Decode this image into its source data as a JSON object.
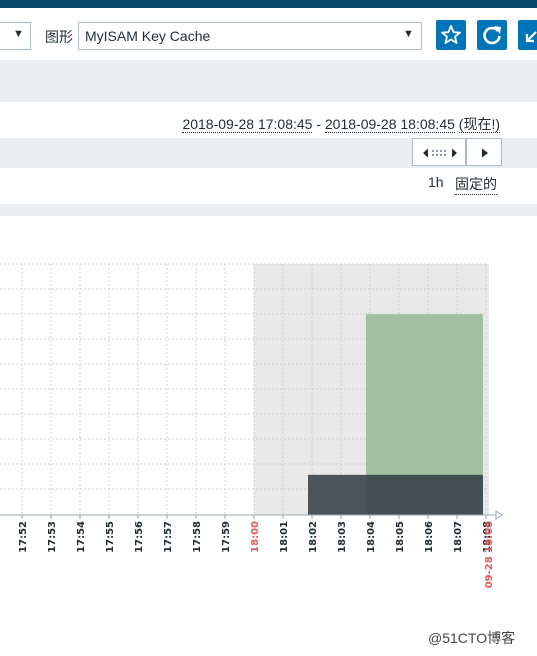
{
  "header": {
    "graph_label": "图形",
    "graph_select_value": "MyISAM Key Cache",
    "buttons": {
      "favorite_icon": "star-icon",
      "refresh_icon": "refresh-icon",
      "kiosk_icon": "arrows-in-icon"
    }
  },
  "timerange": {
    "from": "2018-09-28 17:08:45",
    "separator": "-",
    "to": "2018-09-28 18:08:45",
    "now_label": "(现在!)"
  },
  "timeline": {
    "period": "1h",
    "fixed_label": "固定的"
  },
  "chart_data": {
    "type": "area",
    "x_tick_labels": [
      "17:52",
      "17:53",
      "17:54",
      "17:55",
      "17:56",
      "17:57",
      "17:58",
      "17:59",
      "18:00",
      "18:01",
      "18:02",
      "18:03",
      "18:04",
      "18:05",
      "18:06",
      "18:07",
      "18:08"
    ],
    "highlight_tick": "18:00",
    "end_label": "09-28 18:08",
    "series": [
      {
        "color": "#a0bfa1",
        "start": "18:04",
        "end": "18:08",
        "level": 0.8
      },
      {
        "color": "#3c474d",
        "start": "18:02",
        "end": "18:08",
        "level": 0.16
      }
    ],
    "colors": {
      "highlight": "#e45959",
      "shaded": "#e8e8e8",
      "grid": "#d0d0d0"
    }
  },
  "watermark": "@51CTO博客"
}
